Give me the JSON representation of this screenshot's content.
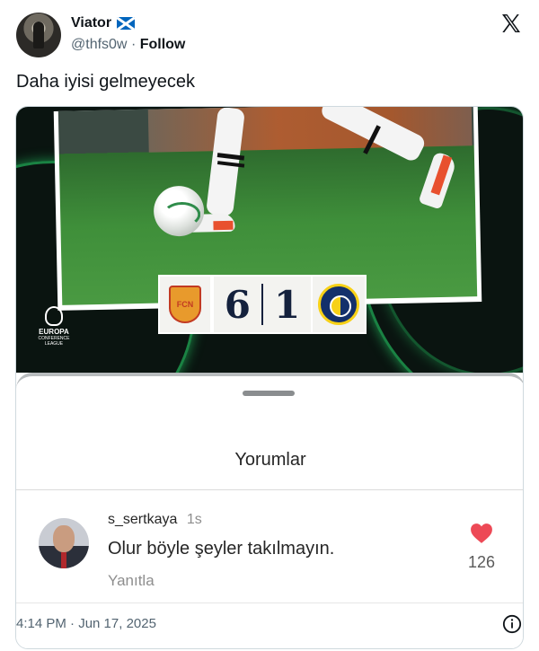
{
  "author": {
    "name": "Viator",
    "flag_icon": "scotland-flag-icon",
    "handle": "@thfs0w",
    "separator": "·",
    "follow_label": "Follow"
  },
  "platform_icon": "x-logo-icon",
  "tweet": {
    "text": "Daha iyisi gelmeyecek"
  },
  "media": {
    "score": {
      "home": "6",
      "away": "1",
      "home_crest_text": "FCN"
    },
    "competition": {
      "line1": "EUROPA",
      "line2": "CONFERENCE",
      "line3": "LEAGUE"
    },
    "comments_sheet": {
      "title": "Yorumlar",
      "comment": {
        "username": "s_sertkaya",
        "time": "1s",
        "text": "Olur böyle şeyler takılmayın.",
        "reply_label": "Yanıtla",
        "likes": "126",
        "like_color": "#ed4956"
      }
    }
  },
  "footer": {
    "timestamp": "4:14 PM · Jun 17, 2025",
    "info_icon": "info-icon"
  }
}
